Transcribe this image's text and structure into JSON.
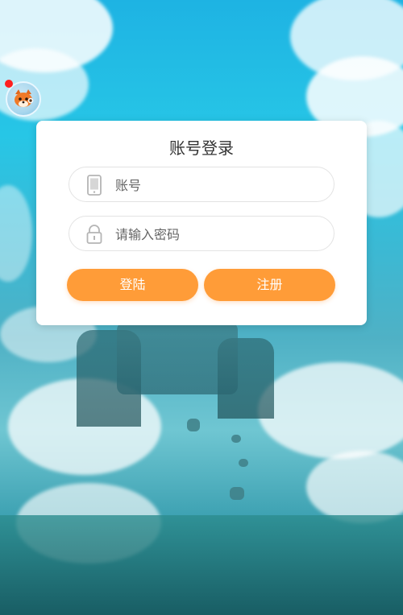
{
  "login": {
    "title": "账号登录",
    "account": {
      "placeholder": "账号",
      "value": ""
    },
    "password": {
      "placeholder": "请输入密码",
      "value": ""
    },
    "login_button": "登陆",
    "register_button": "注册"
  },
  "avatar": {
    "icon": "fox-avatar-icon",
    "notification_dot": true
  },
  "colors": {
    "accent": "#ff9c38",
    "card_bg": "#ffffff",
    "field_border": "#e3e3e3",
    "notification": "#ff1f1f",
    "sky_top": "#1eb3e3"
  },
  "icons": [
    "phone-icon",
    "lock-icon",
    "fox-avatar-icon"
  ]
}
